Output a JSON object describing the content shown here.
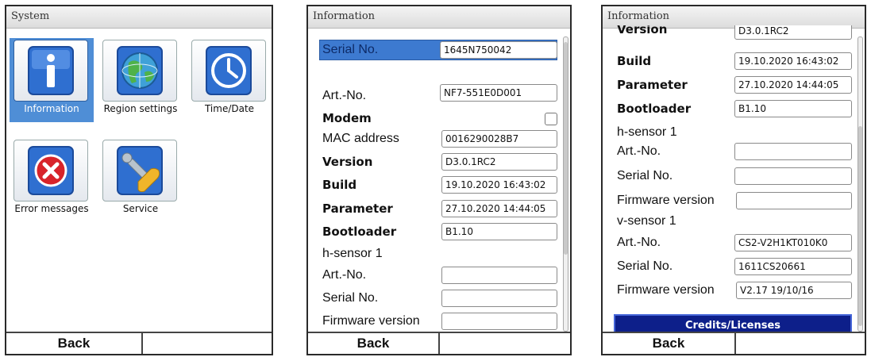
{
  "system_screen": {
    "title": "System",
    "tiles": [
      {
        "label": "Information",
        "icon": "info-icon",
        "selected": true
      },
      {
        "label": "Region settings",
        "icon": "globe-icon",
        "selected": false
      },
      {
        "label": "Time/Date",
        "icon": "clock-icon",
        "selected": false
      },
      {
        "label": "Error messages",
        "icon": "error-icon",
        "selected": false
      },
      {
        "label": "Service",
        "icon": "service-tools-icon",
        "selected": false
      }
    ],
    "back_label": "Back"
  },
  "info_screen_1": {
    "title": "Information",
    "serial_label": "Serial No.",
    "serial_value": "1645N750042",
    "art_no_label": "Art.-No.",
    "art_no_value": "NF7-551E0D001",
    "modem_label": "Modem",
    "mac_label": "MAC address",
    "mac_value": "0016290028B7",
    "version_label": "Version",
    "version_value": "D3.0.1RC2",
    "build_label": "Build",
    "build_value": "19.10.2020 16:43:02",
    "parameter_label": "Parameter",
    "parameter_value": "27.10.2020 14:44:05",
    "bootloader_label": "Bootloader",
    "bootloader_value": "B1.10",
    "hsensor_label": "h-sensor 1",
    "h_art_no_label": "Art.-No.",
    "h_art_no_value": "",
    "h_serial_label": "Serial No.",
    "h_serial_value": "",
    "h_fw_label": "Firmware version",
    "h_fw_value": "",
    "back_label": "Back"
  },
  "info_screen_2": {
    "title": "Information",
    "version_label": "Version",
    "version_value": "D3.0.1RC2",
    "build_label": "Build",
    "build_value": "19.10.2020 16:43:02",
    "parameter_label": "Parameter",
    "parameter_value": "27.10.2020 14:44:05",
    "bootloader_label": "Bootloader",
    "bootloader_value": "B1.10",
    "hsensor_label": "h-sensor 1",
    "h_art_no_label": "Art.-No.",
    "h_art_no_value": "",
    "h_serial_label": "Serial No.",
    "h_serial_value": "",
    "h_fw_label": "Firmware version",
    "h_fw_value": "",
    "vsensor_label": "v-sensor 1",
    "v_art_no_label": "Art.-No.",
    "v_art_no_value": "CS2-V2H1KT010K0",
    "v_serial_label": "Serial No.",
    "v_serial_value": "1611CS20661",
    "v_fw_label": "Firmware version",
    "v_fw_value": "V2.17 19/10/16",
    "credits_label": "Credits/Licenses",
    "back_label": "Back"
  },
  "colors": {
    "selection_blue": "#4f8ed6",
    "credits_navy": "#0d1f8a",
    "border_dark": "#2a2a2a"
  }
}
